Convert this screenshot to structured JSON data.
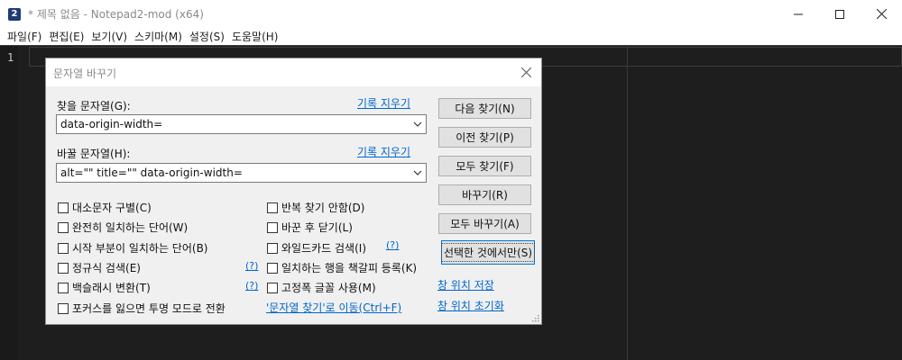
{
  "window": {
    "title": "* 제목 없음 - Notepad2-mod (x64)",
    "icon_glyph": "2"
  },
  "menu": [
    "파일(F)",
    "편집(E)",
    "보기(V)",
    "스키마(M)",
    "설정(S)",
    "도움말(H)"
  ],
  "editor": {
    "line_number": "1"
  },
  "dialog": {
    "title": "문자열 바꾸기",
    "find_label": "찾을 문자열(G):",
    "find_clear": "기록 지우기",
    "find_value": "data-origin-width=",
    "replace_label": "바꿀 문자열(H):",
    "replace_clear": "기록 지우기",
    "replace_value": "alt=\"\" title=\"\" data-origin-width=",
    "buttons": [
      "다음 찾기(N)",
      "이전 찾기(P)",
      "모두 찾기(F)",
      "바꾸기(R)",
      "모두 바꾸기(A)",
      "선택한 것에서만(S)"
    ],
    "left_options": [
      "대소문자 구별(C)",
      "완전히 일치하는 단어(W)",
      "시작 부분이 일치하는 단어(B)",
      "정규식 검색(E)",
      "백슬래시 변환(T)",
      "포커스를 잃으면 투명 모드로 전환"
    ],
    "right_options": [
      "반복 찾기 안함(D)",
      "바꾼 후 닫기(L)",
      "와일드카드 검색(I)",
      "일치하는 행을 책갈피 등록(K)",
      "고정폭 글꼴 사용(M)"
    ],
    "help_mark": "(?)",
    "goto_find_link": "'문자열 찾기'로 이동(Ctrl+F)",
    "save_pos_link": "창 위치 저장",
    "reset_pos_link": "창 위치 초기화"
  }
}
